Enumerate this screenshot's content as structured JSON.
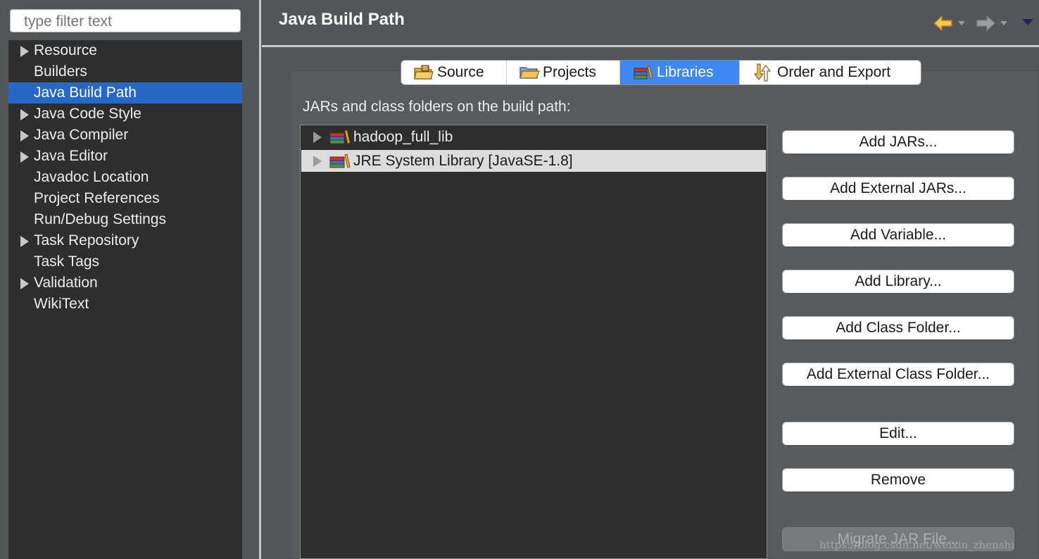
{
  "filter": {
    "placeholder": "type filter text"
  },
  "tree": {
    "items": [
      {
        "label": "Resource",
        "expandable": true,
        "selected": false
      },
      {
        "label": "Builders",
        "expandable": false,
        "selected": false
      },
      {
        "label": "Java Build Path",
        "expandable": false,
        "selected": true
      },
      {
        "label": "Java Code Style",
        "expandable": true,
        "selected": false
      },
      {
        "label": "Java Compiler",
        "expandable": true,
        "selected": false
      },
      {
        "label": "Java Editor",
        "expandable": true,
        "selected": false
      },
      {
        "label": "Javadoc Location",
        "expandable": false,
        "selected": false
      },
      {
        "label": "Project References",
        "expandable": false,
        "selected": false
      },
      {
        "label": "Run/Debug Settings",
        "expandable": false,
        "selected": false
      },
      {
        "label": "Task Repository",
        "expandable": true,
        "selected": false
      },
      {
        "label": "Task Tags",
        "expandable": false,
        "selected": false
      },
      {
        "label": "Validation",
        "expandable": true,
        "selected": false
      },
      {
        "label": "WikiText",
        "expandable": false,
        "selected": false
      }
    ]
  },
  "header": {
    "title": "Java Build Path",
    "icons": [
      "back-arrow-icon",
      "forward-arrow-icon",
      "view-menu-icon"
    ]
  },
  "tabs": [
    {
      "label": "Source",
      "icon": "source-folder-icon",
      "active": false
    },
    {
      "label": "Projects",
      "icon": "projects-folder-icon",
      "active": false
    },
    {
      "label": "Libraries",
      "icon": "libraries-icon",
      "active": true
    },
    {
      "label": "Order and Export",
      "icon": "order-export-icon",
      "active": false
    }
  ],
  "libraries": {
    "section_label": "JARs and class folders on the build path:",
    "items": [
      {
        "label": "hadoop_full_lib",
        "icon": "library-icon",
        "selected": false
      },
      {
        "label": "JRE System Library [JavaSE-1.8]",
        "icon": "library-icon",
        "selected": true
      }
    ]
  },
  "buttons": [
    {
      "label": "Add JARs...",
      "enabled": true
    },
    {
      "label": "Add External JARs...",
      "enabled": true
    },
    {
      "label": "Add Variable...",
      "enabled": true
    },
    {
      "label": "Add Library...",
      "enabled": true
    },
    {
      "label": "Add Class Folder...",
      "enabled": true
    },
    {
      "label": "Add External Class Folder...",
      "enabled": true
    },
    {
      "label": "Edit...",
      "enabled": true
    },
    {
      "label": "Remove",
      "enabled": true
    },
    {
      "label": "Migrate JAR File...",
      "enabled": false
    }
  ],
  "watermark": "https://blog.csdn.net/weixin_zhenshi",
  "colors": {
    "selection": "#2767c6",
    "active_tab": "#3d88f3",
    "tree_bg": "#2e2e2f",
    "panel_bg": "#525658"
  }
}
